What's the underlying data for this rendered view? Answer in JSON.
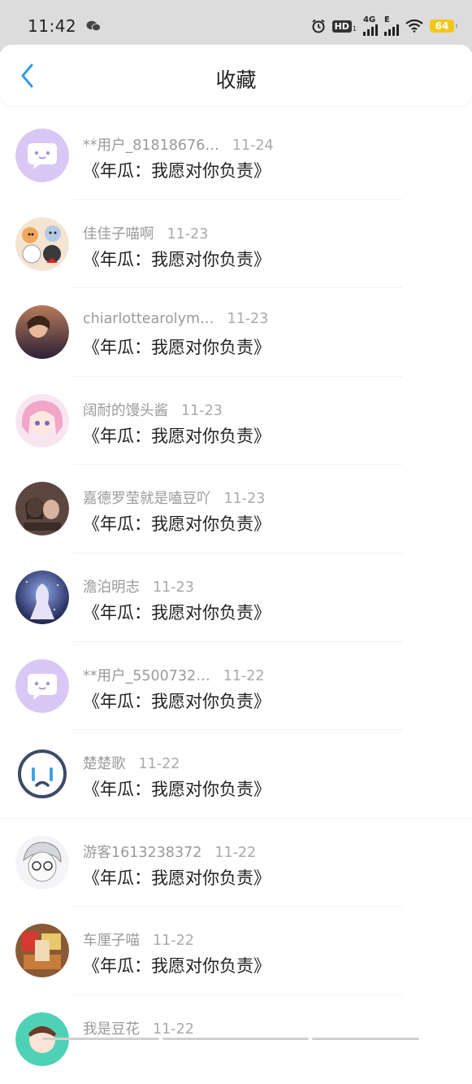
{
  "status_bar": {
    "time": "11:42",
    "hd": "HD",
    "hd_sub": "1",
    "net1": "4G",
    "net2": "E",
    "battery": "64"
  },
  "header": {
    "title": "收藏",
    "back_icon": "chevron-left-icon"
  },
  "colors": {
    "accent": "#2f9bea",
    "status_bg": "#dcdcdc",
    "battery": "#f3c61a"
  },
  "items": [
    {
      "name": "**用户_81818676…",
      "date": "11-24",
      "text": "《年瓜：我愿对你负责》",
      "avatar": "default-chat-avatar"
    },
    {
      "name": "佳佳子喵啊",
      "date": "11-23",
      "text": "《年瓜：我愿对你负责》",
      "avatar": "cartoon-cats-avatar"
    },
    {
      "name": "chiarlottearolym…",
      "date": "11-23",
      "text": "《年瓜：我愿对你负责》",
      "avatar": "photo-avatar"
    },
    {
      "name": "阔耐的馒头酱",
      "date": "11-23",
      "text": "《年瓜：我愿对你负责》",
      "avatar": "anime-pink-avatar"
    },
    {
      "name": "嘉德罗莹就是嗑豆吖",
      "date": "11-23",
      "text": "《年瓜：我愿对你负责》",
      "avatar": "photo-avatar"
    },
    {
      "name": "澹泊明志",
      "date": "11-23",
      "text": "《年瓜：我愿对你负责》",
      "avatar": "anime-night-avatar"
    },
    {
      "name": "**用户_5500732…",
      "date": "11-22",
      "text": "《年瓜：我愿对你负责》",
      "avatar": "default-chat-avatar"
    },
    {
      "name": "楚楚歌",
      "date": "11-22",
      "text": "《年瓜：我愿对你负责》",
      "avatar": "crying-face-avatar"
    },
    {
      "name": "游客1613238372",
      "date": "11-22",
      "text": "《年瓜：我愿对你负责》",
      "avatar": "sketch-avatar"
    },
    {
      "name": "车厘子喵",
      "date": "11-22",
      "text": "《年瓜：我愿对你负责》",
      "avatar": "photo-avatar"
    },
    {
      "name": "我是豆花",
      "date": "11-22",
      "text": "",
      "avatar": "cartoon-avatar"
    }
  ]
}
